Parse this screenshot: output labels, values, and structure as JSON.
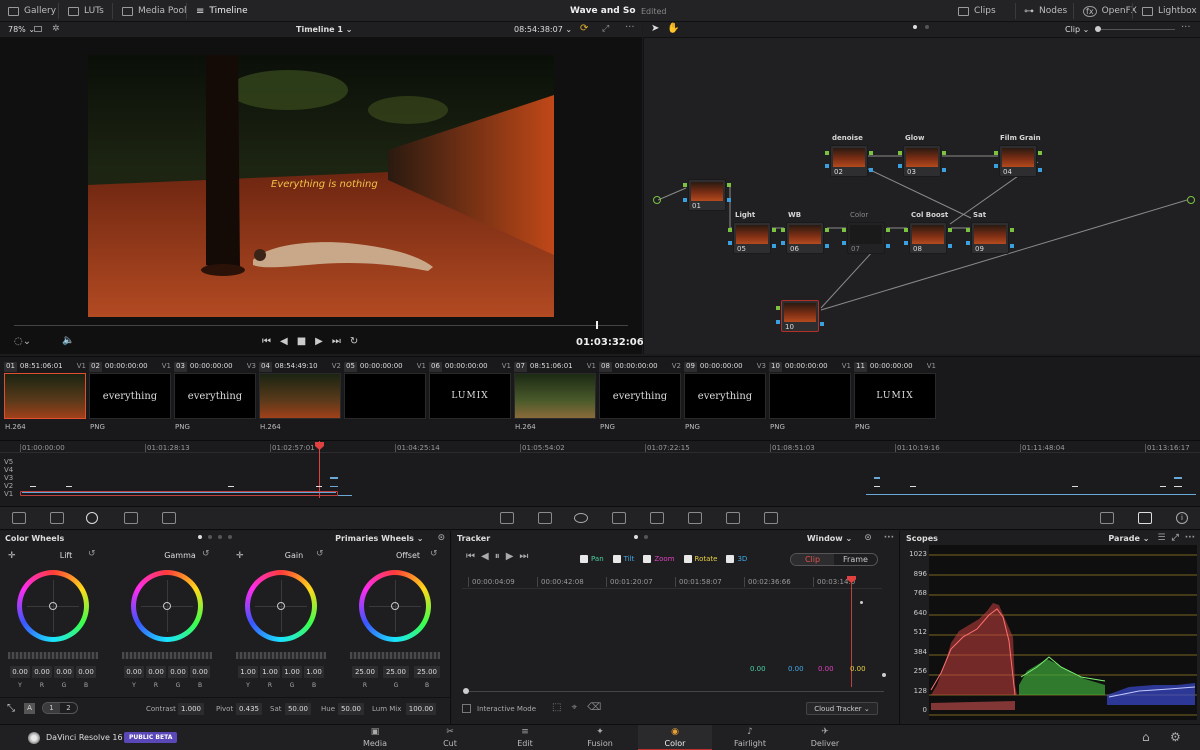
{
  "topbar": {
    "gallery": "Gallery",
    "luts": "LUTs",
    "media_pool": "Media Pool",
    "timeline": "Timeline",
    "project": "Wave and So",
    "status": "Edited",
    "clips": "Clips",
    "nodes": "Nodes",
    "openfx": "OpenFX",
    "lightbox": "Lightbox"
  },
  "viewer": {
    "zoom": "78%",
    "timeline_name": "Timeline 1",
    "timecode": "08:54:38:07",
    "playhead_tc": "01:03:32:06",
    "subtitle": "Everything is nothing"
  },
  "node_editor": {
    "mode": "Clip",
    "nodes": [
      {
        "id": "01",
        "label": ""
      },
      {
        "id": "02",
        "label": "denoise"
      },
      {
        "id": "03",
        "label": "Glow"
      },
      {
        "id": "04",
        "label": "Film Grain"
      },
      {
        "id": "05",
        "label": "Light"
      },
      {
        "id": "06",
        "label": "WB"
      },
      {
        "id": "07",
        "label": "Color"
      },
      {
        "id": "08",
        "label": "Col Boost"
      },
      {
        "id": "09",
        "label": "Sat"
      },
      {
        "id": "10",
        "label": ""
      }
    ]
  },
  "clips": [
    {
      "num": "01",
      "tc": "08:51:06:01",
      "track": "V1",
      "type": "H.264",
      "thumb": ""
    },
    {
      "num": "02",
      "tc": "00:00:00:00",
      "track": "V1",
      "type": "PNG",
      "thumb": "everything"
    },
    {
      "num": "03",
      "tc": "00:00:00:00",
      "track": "V3",
      "type": "PNG",
      "thumb": "everything"
    },
    {
      "num": "04",
      "tc": "08:54:49:10",
      "track": "V2",
      "type": "H.264",
      "thumb": ""
    },
    {
      "num": "05",
      "tc": "00:00:00:00",
      "track": "V1",
      "type": "",
      "thumb": ""
    },
    {
      "num": "06",
      "tc": "00:00:00:00",
      "track": "V1",
      "type": "",
      "thumb": "LUMIX"
    },
    {
      "num": "07",
      "tc": "08:51:06:01",
      "track": "V1",
      "type": "H.264",
      "thumb": ""
    },
    {
      "num": "08",
      "tc": "00:00:00:00",
      "track": "V2",
      "type": "PNG",
      "thumb": "everything"
    },
    {
      "num": "09",
      "tc": "00:00:00:00",
      "track": "V3",
      "type": "PNG",
      "thumb": "everything"
    },
    {
      "num": "10",
      "tc": "00:00:00:00",
      "track": "V1",
      "type": "PNG",
      "thumb": ""
    },
    {
      "num": "11",
      "tc": "00:00:00:00",
      "track": "V1",
      "type": "PNG",
      "thumb": "LUMIX"
    }
  ],
  "timeline": {
    "ruler": [
      "01:00:00:00",
      "01:01:28:13",
      "01:02:57:01",
      "01:04:25:14",
      "01:05:54:02",
      "01:07:22:15",
      "01:08:51:03",
      "01:10:19:16",
      "01:11:48:04",
      "01:13:16:17"
    ],
    "tracks": [
      "V5",
      "V4",
      "V3",
      "V2",
      "V1"
    ]
  },
  "color_wheels": {
    "title": "Color Wheels",
    "mode": "Primaries Wheels",
    "wheels": [
      {
        "name": "Lift",
        "values": [
          "0.00",
          "0.00",
          "0.00",
          "0.00"
        ]
      },
      {
        "name": "Gamma",
        "values": [
          "0.00",
          "0.00",
          "0.00",
          "0.00"
        ]
      },
      {
        "name": "Gain",
        "values": [
          "1.00",
          "1.00",
          "1.00",
          "1.00"
        ]
      },
      {
        "name": "Offset",
        "values": [
          "25.00",
          "25.00",
          "25.00"
        ]
      }
    ],
    "labels4": [
      "Y",
      "R",
      "G",
      "B"
    ],
    "labels3": [
      "R",
      "G",
      "B"
    ],
    "pages": [
      "1",
      "2"
    ],
    "params": {
      "contrast_label": "Contrast",
      "contrast": "1.000",
      "pivot_label": "Pivot",
      "pivot": "0.435",
      "sat_label": "Sat",
      "sat": "50.00",
      "hue_label": "Hue",
      "hue": "50.00",
      "lummix_label": "Lum Mix",
      "lummix": "100.00"
    }
  },
  "tracker": {
    "title": "Tracker",
    "window": "Window",
    "checks": [
      "Pan",
      "Tilt",
      "Zoom",
      "Rotate",
      "3D"
    ],
    "seg_clip": "Clip",
    "seg_frame": "Frame",
    "ruler": [
      "00:00:04:09",
      "00:00:42:08",
      "00:01:20:07",
      "00:01:58:07",
      "00:02:36:66",
      "00:03:14:0"
    ],
    "values": [
      "0.00",
      "0.00",
      "0.00",
      "0.00"
    ],
    "interactive": "Interactive Mode",
    "cloud": "Cloud Tracker"
  },
  "scopes": {
    "title": "Scopes",
    "mode": "Parade",
    "scale": [
      "1023",
      "896",
      "768",
      "640",
      "512",
      "384",
      "256",
      "128",
      "0"
    ]
  },
  "bottom": {
    "app": "DaVinci Resolve 16",
    "beta": "PUBLIC BETA",
    "pages": [
      "Media",
      "Cut",
      "Edit",
      "Fusion",
      "Color",
      "Fairlight",
      "Deliver"
    ],
    "active": "Color"
  }
}
